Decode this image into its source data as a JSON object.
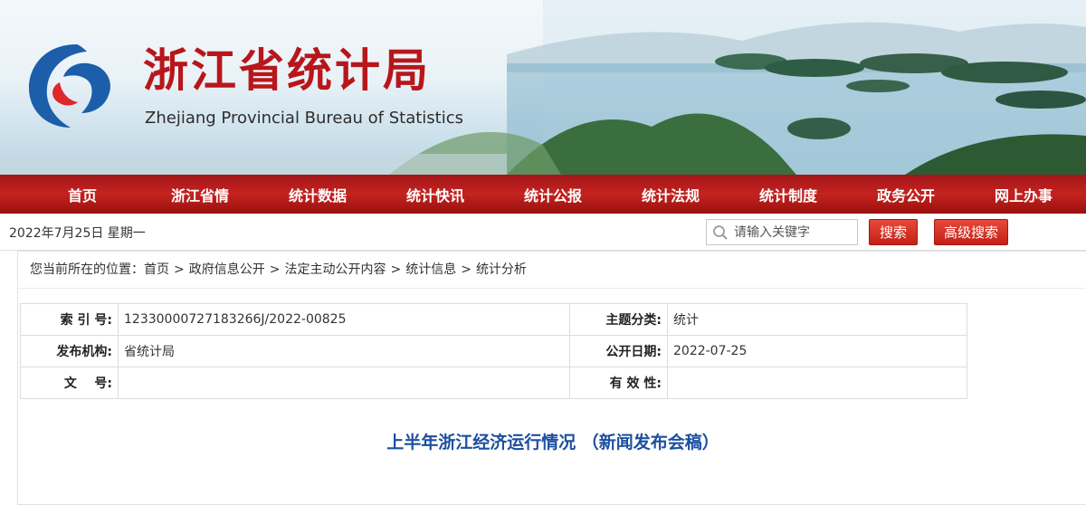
{
  "header": {
    "site_title": "浙江省统计局",
    "site_subtitle": "Zhejiang Provincial Bureau of Statistics"
  },
  "nav": {
    "items": [
      "首页",
      "浙江省情",
      "统计数据",
      "统计快讯",
      "统计公报",
      "统计法规",
      "统计制度",
      "政务公开",
      "网上办事"
    ]
  },
  "topbar": {
    "date": "2022年7月25日 星期一",
    "search_placeholder": "请输入关键字",
    "search_button": "搜索",
    "advanced_search_button": "高级搜索"
  },
  "breadcrumb": {
    "prefix": "您当前所在的位置：",
    "items": [
      "首页",
      "政府信息公开",
      "法定主动公开内容",
      "统计信息",
      "统计分析"
    ],
    "separator": ">"
  },
  "meta": {
    "index_label": "索 引 号:",
    "index_value": "12330000727183266J/2022-00825",
    "topic_label": "主题分类:",
    "topic_value": "统计",
    "publisher_label": "发布机构:",
    "publisher_value": "省统计局",
    "date_label": "公开日期:",
    "date_value": "2022-07-25",
    "docno_label": "文    号:",
    "docno_value": "",
    "validity_label": "有 效 性:",
    "validity_value": ""
  },
  "article": {
    "title": "上半年浙江经济运行情况 （新闻发布会稿）"
  },
  "colors": {
    "brand_red": "#b8161b",
    "nav_red": "#c4231f",
    "title_blue": "#1b4fa0"
  }
}
